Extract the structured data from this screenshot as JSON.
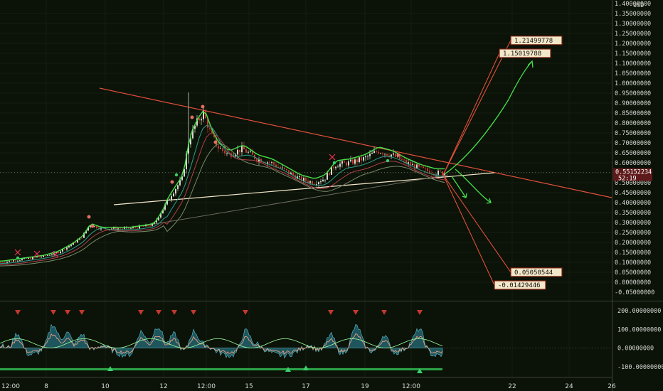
{
  "chart_data": {
    "type": "candlestick",
    "currency": "USD",
    "price_axis": {
      "ylim": [
        -0.05,
        1.4
      ],
      "tick_labels": [
        "1.40000000",
        "1.35000000",
        "1.30000000",
        "1.25000000",
        "1.20000000",
        "1.15000000",
        "1.10000000",
        "1.05000000",
        "1.00000000",
        "0.95000000",
        "0.90000000",
        "0.85000000",
        "0.80000000",
        "0.75000000",
        "0.70000000",
        "0.65000000",
        "0.60000000",
        "0.55000000",
        "0.50000000",
        "0.45000000",
        "0.40000000",
        "0.35000000",
        "0.30000000",
        "0.25000000",
        "0.20000000",
        "0.15000000",
        "0.10000000",
        "0.05000000",
        "0.00000000",
        "-0.05000000"
      ]
    },
    "oscillator_axis": {
      "ylim": [
        -150,
        220
      ],
      "tick_labels": [
        "200.00000000",
        "100.00000000",
        "0.00000000",
        "-100.00000000"
      ]
    },
    "x_axis": {
      "tick_labels": [
        "12:00",
        "8",
        "10",
        "12",
        "12:00",
        "15",
        "17",
        "19",
        "12:00",
        "22",
        "24",
        "26"
      ]
    },
    "current_price": {
      "value": 0.55152234,
      "label": "0.55152234",
      "countdown": "52:19"
    },
    "annotations": [
      {
        "label": "1.21499778",
        "value": 1.21499778
      },
      {
        "label": "1.15019788",
        "value": 1.15019788
      },
      {
        "label": "0.05050544",
        "value": 0.05050544
      },
      {
        "label": "-0.01429446",
        "value": -0.01429446
      }
    ],
    "price_series": [
      {
        "x": 0,
        "close": 0.1
      },
      {
        "x": 20,
        "close": 0.11
      },
      {
        "x": 40,
        "close": 0.12
      },
      {
        "x": 60,
        "close": 0.13
      },
      {
        "x": 80,
        "close": 0.15
      },
      {
        "x": 100,
        "close": 0.19
      },
      {
        "x": 115,
        "close": 0.23
      },
      {
        "x": 125,
        "close": 0.29
      },
      {
        "x": 140,
        "close": 0.27
      },
      {
        "x": 160,
        "close": 0.27
      },
      {
        "x": 180,
        "close": 0.27
      },
      {
        "x": 200,
        "close": 0.28
      },
      {
        "x": 215,
        "close": 0.29
      },
      {
        "x": 225,
        "close": 0.35
      },
      {
        "x": 240,
        "close": 0.44
      },
      {
        "x": 255,
        "close": 0.52
      },
      {
        "x": 265,
        "close": 0.72
      },
      {
        "x": 275,
        "close": 0.8
      },
      {
        "x": 285,
        "close": 0.85
      },
      {
        "x": 295,
        "close": 0.75
      },
      {
        "x": 305,
        "close": 0.68
      },
      {
        "x": 320,
        "close": 0.64
      },
      {
        "x": 340,
        "close": 0.67
      },
      {
        "x": 360,
        "close": 0.62
      },
      {
        "x": 380,
        "close": 0.6
      },
      {
        "x": 400,
        "close": 0.56
      },
      {
        "x": 420,
        "close": 0.52
      },
      {
        "x": 440,
        "close": 0.5
      },
      {
        "x": 455,
        "close": 0.52
      },
      {
        "x": 470,
        "close": 0.59
      },
      {
        "x": 490,
        "close": 0.6
      },
      {
        "x": 510,
        "close": 0.62
      },
      {
        "x": 530,
        "close": 0.66
      },
      {
        "x": 550,
        "close": 0.64
      },
      {
        "x": 570,
        "close": 0.6
      },
      {
        "x": 590,
        "close": 0.57
      },
      {
        "x": 610,
        "close": 0.55
      },
      {
        "x": 625,
        "close": 0.55
      }
    ]
  }
}
